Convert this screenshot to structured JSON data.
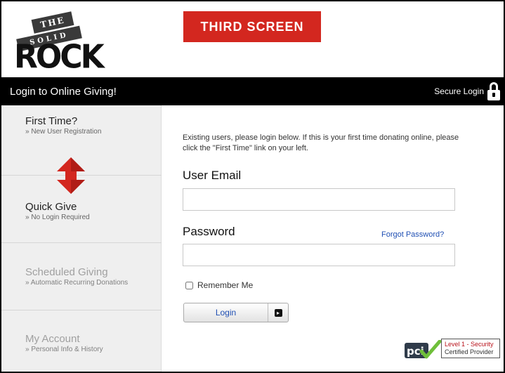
{
  "logo": {
    "line1": "THE",
    "line2": "SOLID",
    "line3": "ROCK"
  },
  "screen_label": "THIRD  SCREEN",
  "topbar": {
    "title": "Login to Online Giving!",
    "secure_label": "Secure Login",
    "secure_icon": "lock-icon"
  },
  "sidebar": {
    "items": [
      {
        "label": "First Time?",
        "sub": "» New User Registration",
        "state": "enabled"
      },
      {
        "label": "Quick Give",
        "sub": "» No Login Required",
        "state": "enabled"
      },
      {
        "label": "Scheduled Giving",
        "sub": "» Automatic Recurring Donations",
        "state": "disabled"
      },
      {
        "label": "My Account",
        "sub": "» Personal Info & History",
        "state": "disabled"
      }
    ],
    "arrow_icon": "double-arrow-icon",
    "arrow_color": "#d3271f"
  },
  "login": {
    "intro": "Existing users, please login below. If this is your first time donating online, please click the \"First Time\" link on your left.",
    "email_label": "User Email",
    "email_value": "",
    "password_label": "Password",
    "password_value": "",
    "forgot_link": "Forgot Password?",
    "remember_label": "Remember Me",
    "remember_checked": false,
    "button_label": "Login",
    "button_icon": "arrow-right-icon"
  },
  "badge": {
    "logo_text": "pci",
    "line1": "Level 1 - Security",
    "line2": "Certified Provider"
  },
  "colors": {
    "accent_red": "#d3271f",
    "link_blue": "#1f4fb3",
    "topbar_bg": "#000000",
    "sidebar_bg": "#efefef"
  }
}
